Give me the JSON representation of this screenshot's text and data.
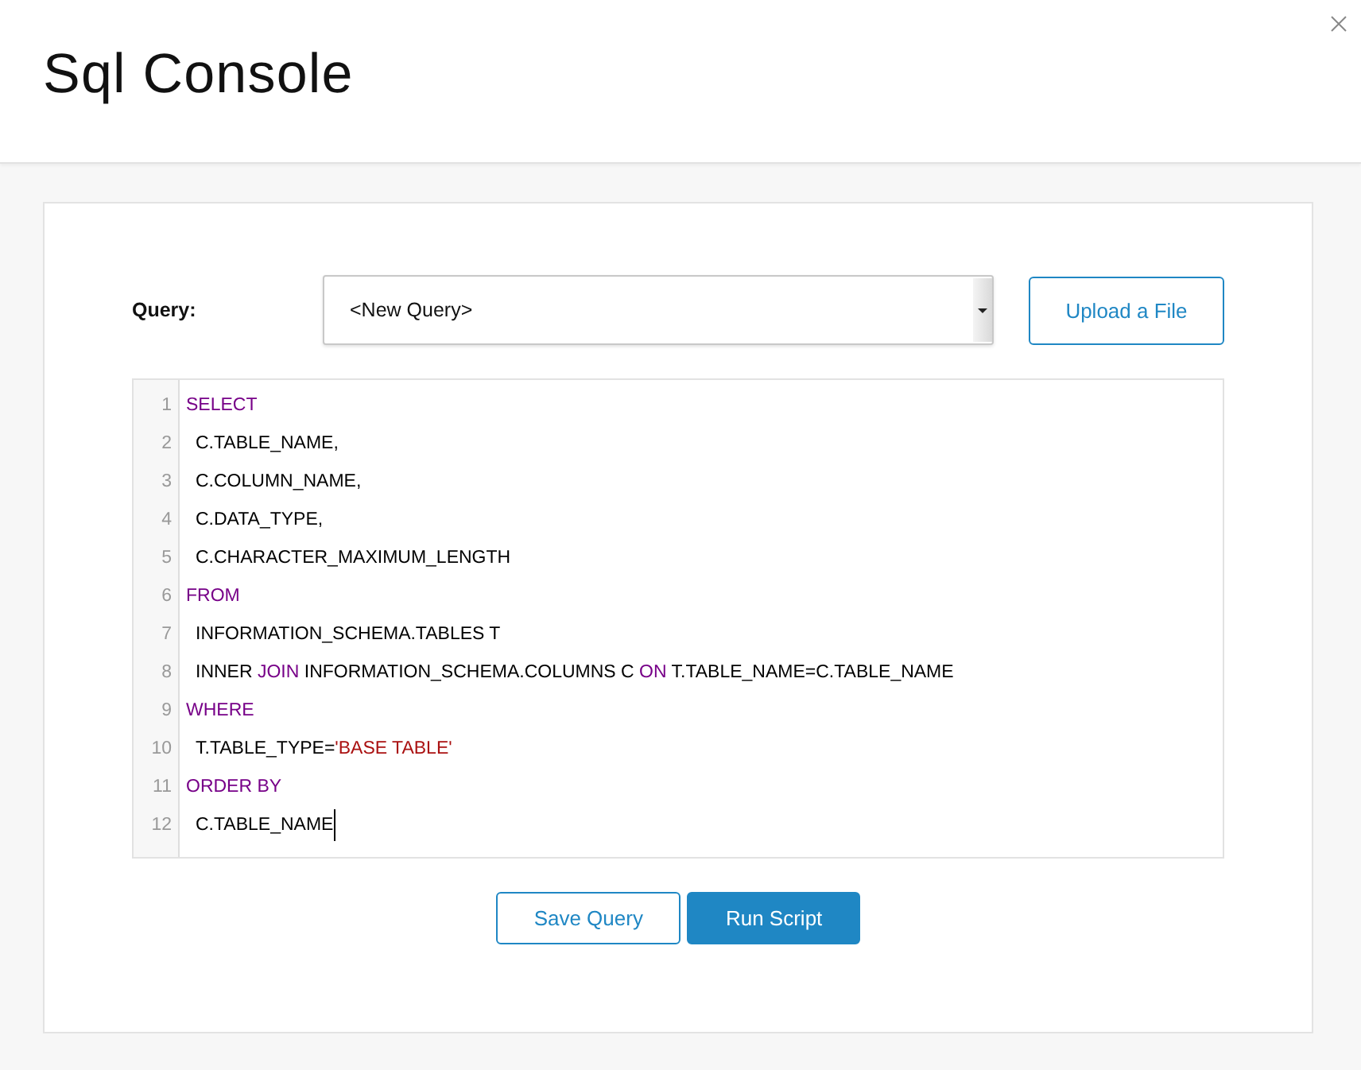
{
  "dialog": {
    "title": "Sql Console"
  },
  "query": {
    "label": "Query:",
    "select": {
      "value": "<New Query>"
    },
    "upload_button": {
      "label": "Upload a File"
    }
  },
  "editor": {
    "lines": [
      {
        "number": "1",
        "cursor": false,
        "tokens": [
          {
            "kind": "keyword",
            "text": "SELECT"
          }
        ],
        "children": [
          {
            "number": "2",
            "cursor": false,
            "tokens": [
              {
                "kind": "plain",
                "text": "C.TABLE_NAME,"
              }
            ]
          },
          {
            "number": "3",
            "cursor": false,
            "tokens": [
              {
                "kind": "plain",
                "text": "C.COLUMN_NAME,"
              }
            ]
          },
          {
            "number": "4",
            "cursor": false,
            "tokens": [
              {
                "kind": "plain",
                "text": "C.DATA_TYPE,"
              }
            ]
          },
          {
            "number": "5",
            "cursor": false,
            "tokens": [
              {
                "kind": "plain",
                "text": "C.CHARACTER_MAXIMUM_LENGTH"
              }
            ]
          }
        ]
      },
      {
        "number": "6",
        "cursor": false,
        "tokens": [
          {
            "kind": "keyword",
            "text": "FROM"
          }
        ],
        "children": [
          {
            "number": "7",
            "cursor": false,
            "tokens": [
              {
                "kind": "plain",
                "text": "INFORMATION_SCHEMA.TABLES T"
              }
            ]
          },
          {
            "number": "8",
            "cursor": false,
            "tokens": [
              {
                "kind": "plain",
                "text": "INNER "
              },
              {
                "kind": "keyword",
                "text": "JOIN"
              },
              {
                "kind": "plain",
                "text": " INFORMATION_SCHEMA.COLUMNS C "
              },
              {
                "kind": "keyword",
                "text": "ON"
              },
              {
                "kind": "plain",
                "text": " T.TABLE_NAME=C.TABLE_NAME"
              }
            ]
          }
        ]
      },
      {
        "number": "9",
        "cursor": false,
        "tokens": [
          {
            "kind": "keyword",
            "text": "WHERE"
          }
        ],
        "children": [
          {
            "number": "10",
            "cursor": false,
            "tokens": [
              {
                "kind": "plain",
                "text": "T.TABLE_TYPE="
              },
              {
                "kind": "string",
                "text": "'BASE TABLE'"
              }
            ]
          }
        ]
      },
      {
        "number": "11",
        "cursor": false,
        "tokens": [
          {
            "kind": "keyword",
            "text": "ORDER BY"
          }
        ],
        "children": [
          {
            "number": "12",
            "cursor": true,
            "tokens": [
              {
                "kind": "plain",
                "text": "C.TABLE_NAME"
              }
            ]
          }
        ]
      }
    ]
  },
  "actions": [
    {
      "label": "Save Query",
      "kind": "outline"
    },
    {
      "label": "Run Script",
      "kind": "primary"
    }
  ]
}
